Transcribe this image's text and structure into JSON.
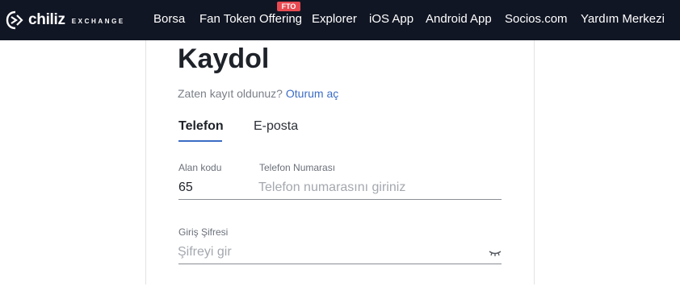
{
  "brand": {
    "name": "chiliz",
    "sub": "EXCHANGE",
    "logo_icon": "chiliz-swirl-icon"
  },
  "nav": {
    "items": [
      {
        "label": "Borsa"
      },
      {
        "label": "Fan Token Offering"
      },
      {
        "label": "Explorer"
      },
      {
        "label": "iOS App"
      },
      {
        "label": "Android App"
      },
      {
        "label": "Socios.com"
      },
      {
        "label": "Yardım Merkezi"
      }
    ],
    "fto_badge": "FTO"
  },
  "form": {
    "title": "Kaydol",
    "subtitle_text": "Zaten kayıt oldunuz?",
    "signin_link": "Oturum aç",
    "tabs": [
      {
        "label": "Telefon",
        "active": true
      },
      {
        "label": "E-posta",
        "active": false
      }
    ],
    "area_code": {
      "label": "Alan kodu",
      "value": "65"
    },
    "phone": {
      "label": "Telefon Numarası",
      "placeholder": "Telefon numarasını giriniz",
      "value": ""
    },
    "password": {
      "label": "Giriş Şifresi",
      "placeholder": "Şifreyi gir",
      "value": "",
      "toggle_icon": "eye-closed-icon"
    }
  },
  "colors": {
    "navbar_bg": "#111624",
    "accent": "#3b6cc5",
    "badge": "#e84a52"
  }
}
